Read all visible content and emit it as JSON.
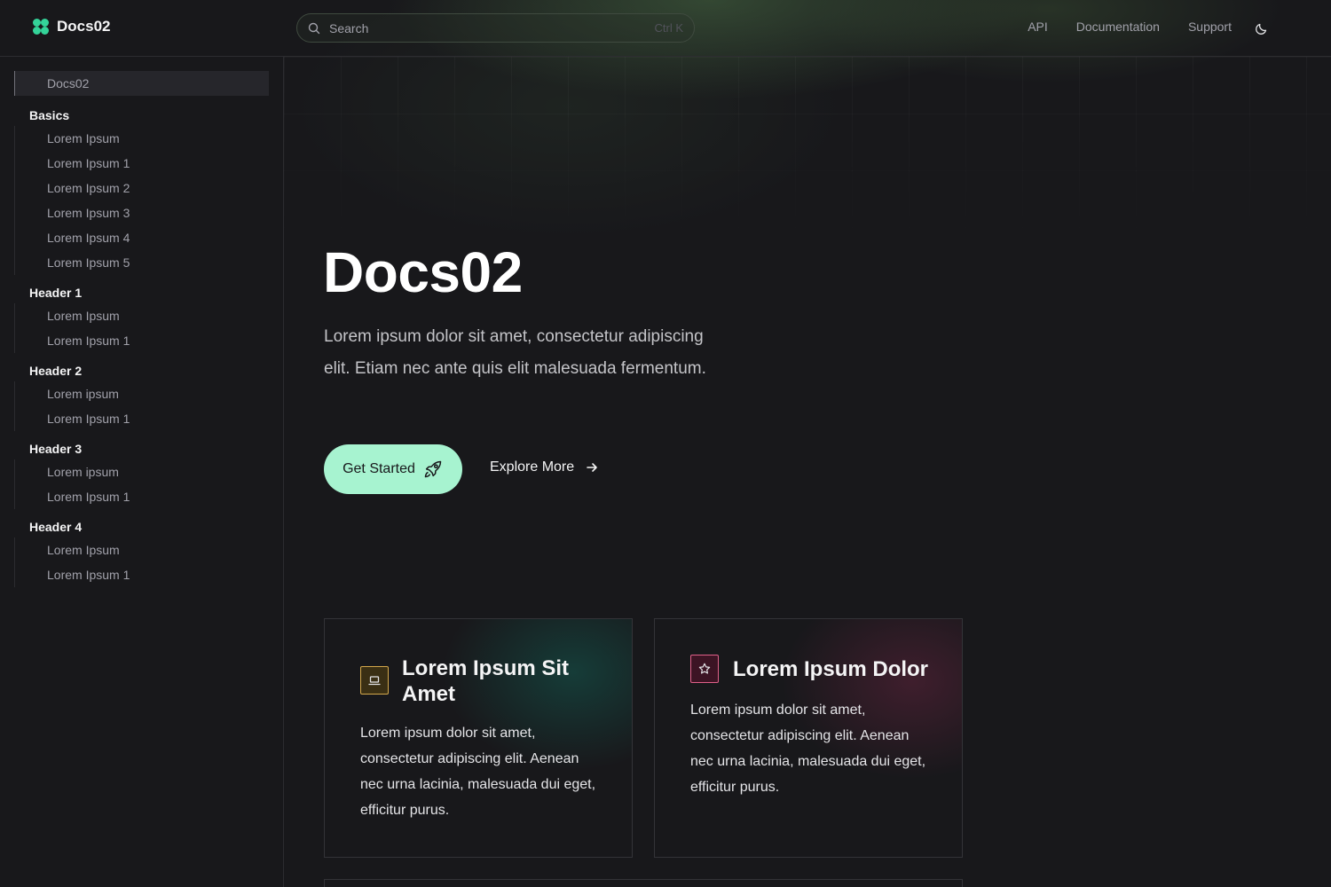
{
  "app": {
    "name": "Docs02"
  },
  "search": {
    "placeholder": "Search",
    "shortcut": "Ctrl K"
  },
  "nav": {
    "items": [
      "API",
      "Documentation",
      "Support"
    ]
  },
  "sidebar": {
    "active": "Docs02",
    "groups": [
      {
        "title": "Basics",
        "items": [
          "Lorem Ipsum",
          "Lorem Ipsum 1",
          "Lorem Ipsum 2",
          "Lorem Ipsum 3",
          "Lorem Ipsum 4",
          "Lorem Ipsum 5"
        ]
      },
      {
        "title": "Header 1",
        "items": [
          "Lorem Ipsum",
          "Lorem Ipsum 1"
        ]
      },
      {
        "title": "Header 2",
        "items": [
          "Lorem ipsum",
          "Lorem Ipsum 1"
        ]
      },
      {
        "title": "Header 3",
        "items": [
          "Lorem ipsum",
          "Lorem Ipsum 1"
        ]
      },
      {
        "title": "Header 4",
        "items": [
          "Lorem Ipsum",
          "Lorem Ipsum 1"
        ]
      }
    ]
  },
  "hero": {
    "title": "Docs02",
    "description": "Lorem ipsum dolor sit amet, consectetur adipiscing elit. Etiam nec ante quis elit malesuada fermentum.",
    "primary_label": "Get Started",
    "secondary_label": "Explore More"
  },
  "cards": [
    {
      "title": "Lorem Ipsum Sit Amet",
      "body": "Lorem ipsum dolor sit amet, consectetur adipiscing elit. Aenean nec urna lacinia, malesuada dui eget, efficitur purus.",
      "icon": "laptop-icon"
    },
    {
      "title": "Lorem Ipsum Dolor",
      "body": "Lorem ipsum dolor sit amet, consectetur adipiscing elit. Aenean nec urna lacinia, malesuada dui eget, efficitur purus.",
      "icon": "star-icon"
    }
  ],
  "colors": {
    "accent": "#a7f3d0",
    "logo": "#34d399",
    "background": "#18181b",
    "card1_icon": "#d4a84b",
    "card2_icon": "#e0608a"
  }
}
